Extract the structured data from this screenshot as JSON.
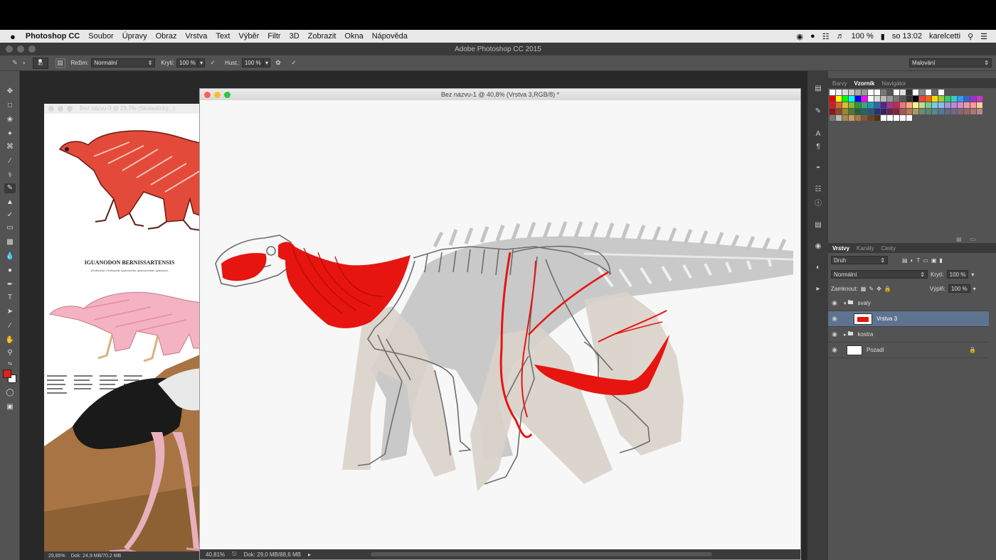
{
  "menubar": {
    "apple": "",
    "app_name": "Photoshop CC",
    "items": [
      "Soubor",
      "Úpravy",
      "Obraz",
      "Vrstva",
      "Text",
      "Výběr",
      "Filtr",
      "3D",
      "Zobrazit",
      "Okna",
      "Nápověda"
    ],
    "battery": "100 %",
    "clock": "so 13:02",
    "user": "karelcetti"
  },
  "app_title": "Adobe Photoshop CC 2015",
  "options_bar": {
    "brush_size": "40",
    "mode_label": "Režim:",
    "mode_value": "Normální",
    "opacity_label": "Krytí:",
    "opacity_value": "100 %",
    "flow_label": "Hust.:",
    "flow_value": "100 %",
    "workspace_value": "Malování"
  },
  "colors": {
    "foreground": "#e0201a",
    "background": "#ffffff",
    "selection": "#5e7390"
  },
  "doc_back": {
    "title": "Bez názvu-3 @ 29,7% (Skolastický...)",
    "heading": "IGUANODON BERNISSARTENSIS",
    "subheading": "(Ornithischia, Ornithopoda, Iguanodontia, Iguanodontidae, Iguanodon)",
    "zoom": "29,85%",
    "doc_info": "Dok: 24,9 MB/70,2 MB"
  },
  "doc_front": {
    "title": "Bez názvu-1 @ 40,8% (Vrstva 3,RGB/8) *",
    "zoom": "40,81%",
    "doc_info": "Dok: 29,0 MB/88,6 MB"
  },
  "swatch_panel": {
    "tabs": [
      "Barvy",
      "Vzorník",
      "Navigátor"
    ],
    "active_tab": "Vzorník"
  },
  "layers_panel": {
    "tabs": [
      "Vrstvy",
      "Kanály",
      "Cesty"
    ],
    "active_tab": "Vrstvy",
    "filter_value": "Druh",
    "blend_value": "Normální",
    "opacity_label": "Krytí:",
    "opacity_value": "100 %",
    "lock_label": "Zamknout:",
    "fill_label": "Výplň:",
    "fill_value": "100 %",
    "layers": [
      {
        "name": "svaly",
        "type": "group"
      },
      {
        "name": "Vrstva 3",
        "type": "layer"
      },
      {
        "name": "kostra",
        "type": "group"
      },
      {
        "name": "Pozadí",
        "type": "background"
      }
    ]
  }
}
